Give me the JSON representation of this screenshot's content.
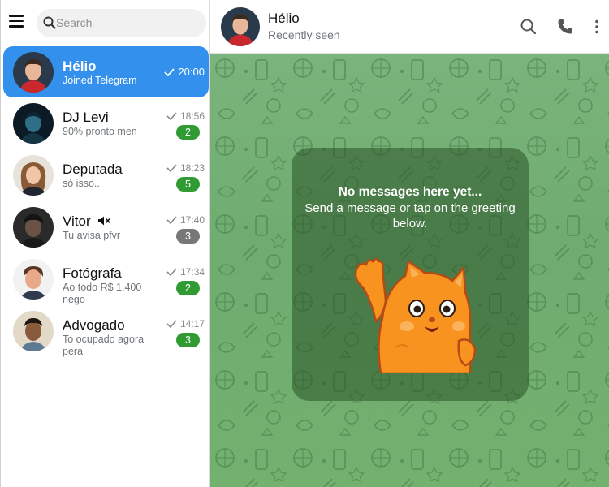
{
  "search": {
    "placeholder": "Search"
  },
  "chats": [
    {
      "name": "Hélio",
      "preview": "Joined Telegram",
      "time": "20:00"
    },
    {
      "name": "DJ Levi",
      "preview": "90% pronto men",
      "time": "18:56",
      "unread": "2"
    },
    {
      "name": "Deputada",
      "preview": "só isso..",
      "time": "18:23",
      "unread": "5"
    },
    {
      "name": "Vitor",
      "preview": "Tu avisa pfvr",
      "time": "17:40",
      "unread": "3",
      "muted": true
    },
    {
      "name": "Fotógrafa",
      "preview": "Ao todo R$ 1.400 nego",
      "time": "17:34",
      "unread": "2"
    },
    {
      "name": "Advogado",
      "preview": "To ocupado agora pera",
      "time": "14:17",
      "unread": "3"
    }
  ],
  "header": {
    "name": "Hélio",
    "status": "Recently seen"
  },
  "empty": {
    "title": "No messages here yet...",
    "text": "Send a message or tap on the greeting below."
  },
  "colors": {
    "accent": "#3390ec",
    "badge": "#2f9b32",
    "badge_muted": "#777777",
    "chat_bg": "#74b073"
  },
  "icons": [
    "menu-icon",
    "search-icon",
    "check-icon",
    "mute-icon",
    "phone-icon",
    "more-icon"
  ]
}
